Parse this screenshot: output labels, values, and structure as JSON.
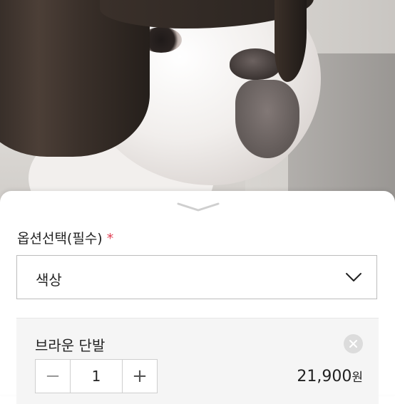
{
  "photo": {
    "alt_icon": "bulldog-wig-photo"
  },
  "sheet": {
    "handle_icon": "chevron-down-handle-icon",
    "option_label": "옵션선택(필수)",
    "required_mark": "*",
    "select": {
      "value": "색상",
      "icon": "chevron-down-icon"
    },
    "selected_option": {
      "name": "브라운 단발",
      "remove_icon": "close-icon",
      "quantity": "1",
      "minus_label": "−",
      "plus_label": "+",
      "price": "21,900",
      "price_unit": "원"
    }
  },
  "colors": {
    "required": "#e03e52",
    "border": "#bdbdbd",
    "card_bg": "#f5f5f5"
  }
}
